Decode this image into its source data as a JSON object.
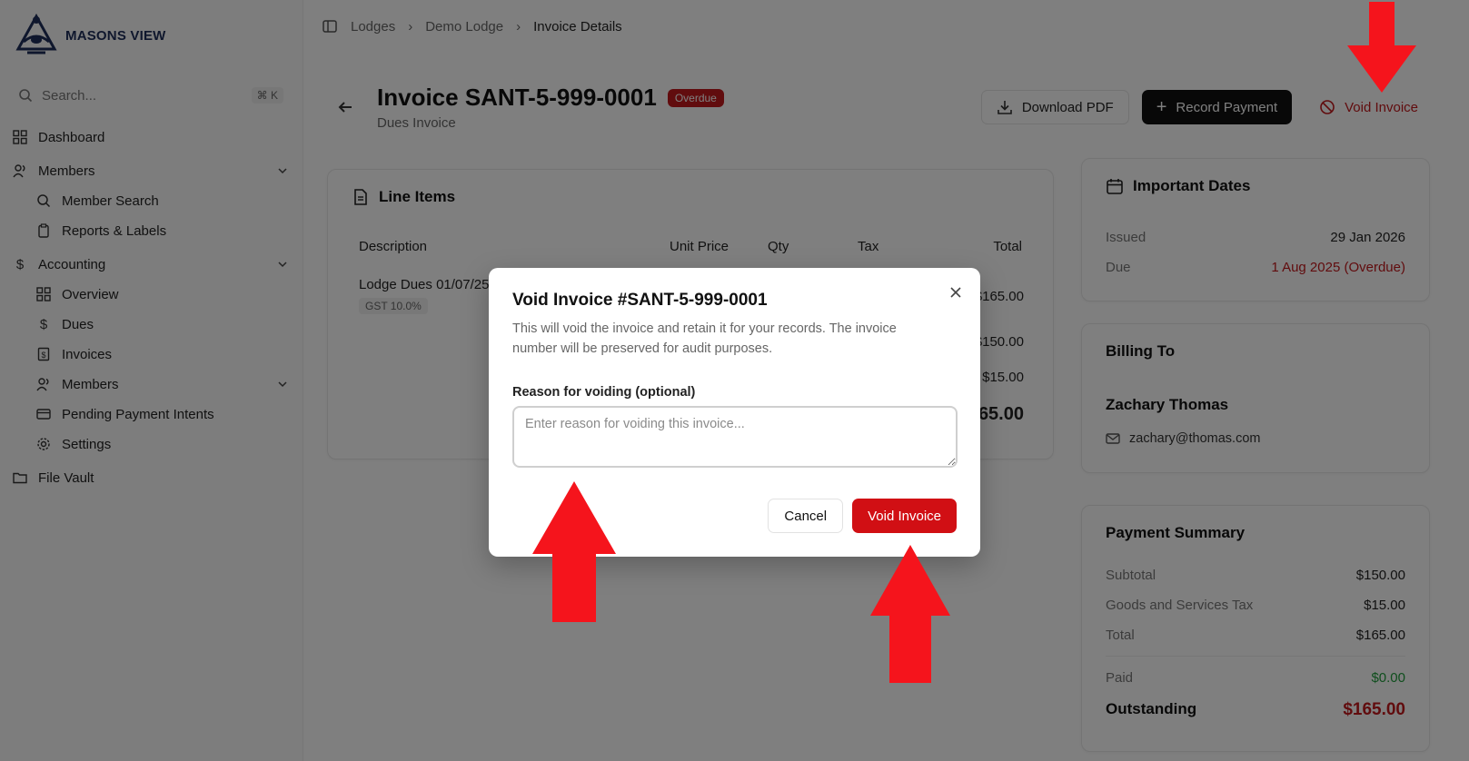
{
  "brand": {
    "name": "MASONS VIEW"
  },
  "search": {
    "placeholder": "Search...",
    "shortcut": "⌘ K"
  },
  "sidebar": {
    "items": [
      {
        "label": "Dashboard"
      },
      {
        "label": "Members"
      },
      {
        "label": "Member Search"
      },
      {
        "label": "Reports & Labels"
      },
      {
        "label": "Accounting"
      },
      {
        "label": "Overview"
      },
      {
        "label": "Dues"
      },
      {
        "label": "Invoices"
      },
      {
        "label": "Members"
      },
      {
        "label": "Pending Payment Intents"
      },
      {
        "label": "Settings"
      },
      {
        "label": "File Vault"
      }
    ]
  },
  "breadcrumb": {
    "items": [
      "Lodges",
      "Demo Lodge",
      "Invoice Details"
    ]
  },
  "invoice": {
    "title": "Invoice SANT-5-999-0001",
    "status": "Overdue",
    "subtitle": "Dues Invoice"
  },
  "actions": {
    "download": "Download PDF",
    "record": "Record Payment",
    "void": "Void Invoice"
  },
  "line_items": {
    "title": "Line Items",
    "headers": [
      "Description",
      "Unit Price",
      "Qty",
      "Tax",
      "Total"
    ],
    "row_description": "Lodge Dues 01/07/25",
    "row_tax_tag": "GST 10.0%",
    "row_total": "$165.00",
    "subtotal": "$150.00",
    "tax": "$15.00",
    "total": "65.00"
  },
  "dates": {
    "title": "Important Dates",
    "issued_label": "Issued",
    "issued_value": "29 Jan 2026",
    "due_label": "Due",
    "due_value": "1 Aug 2025 (Overdue)"
  },
  "billing": {
    "title": "Billing To",
    "name": "Zachary Thomas",
    "email": "zachary@thomas.com"
  },
  "payment": {
    "title": "Payment Summary",
    "subtotal_label": "Subtotal",
    "subtotal_value": "$150.00",
    "gst_label": "Goods and Services Tax",
    "gst_value": "$15.00",
    "total_label": "Total",
    "total_value": "$165.00",
    "paid_label": "Paid",
    "paid_value": "$0.00",
    "outstanding_label": "Outstanding",
    "outstanding_value": "$165.00"
  },
  "modal": {
    "title": "Void Invoice #SANT-5-999-0001",
    "description": "This will void the invoice and retain it for your records. The invoice number will be preserved for audit purposes.",
    "reason_label": "Reason for voiding (optional)",
    "reason_placeholder": "Enter reason for voiding this invoice...",
    "reason_value": "",
    "cancel": "Cancel",
    "confirm": "Void Invoice"
  },
  "colors": {
    "danger": "#d10f14",
    "annotation_arrow": "#f5141c",
    "success": "#1f9d3a"
  }
}
